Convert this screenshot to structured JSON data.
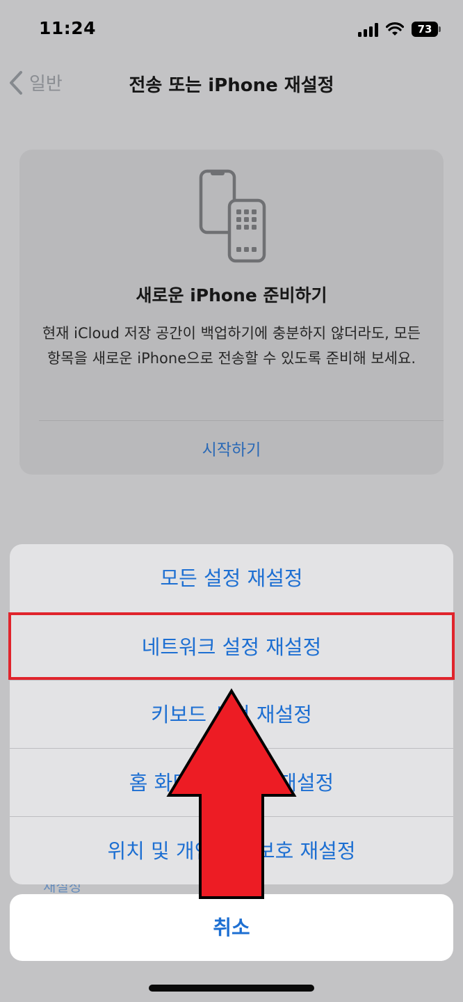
{
  "status_bar": {
    "time": "11:24",
    "battery": "73"
  },
  "nav": {
    "back_label": "일반",
    "title": "전송 또는 iPhone 재설정"
  },
  "card": {
    "title": "새로운 iPhone 준비하기",
    "description": "현재 iCloud 저장 공간이 백업하기에 충분하지 않더라도, 모든 항목을 새로운 iPhone으로 전송할 수 있도록 준비해 보세요.",
    "link": "시작하기"
  },
  "behind_text": "재설정",
  "action_sheet": {
    "items": [
      {
        "label": "모든 설정 재설정"
      },
      {
        "label": "네트워크 설정 재설정"
      },
      {
        "label": "키보드 사전 재설정"
      },
      {
        "label": "홈 화면 레이아웃 재설정"
      },
      {
        "label": "위치 및 개인정보 보호 재설정"
      }
    ],
    "cancel": "취소"
  },
  "annotation": {
    "highlight_color": "#e0242c",
    "arrow_color": "#ed1c24"
  },
  "colors": {
    "accent": "#1d6fd2"
  }
}
